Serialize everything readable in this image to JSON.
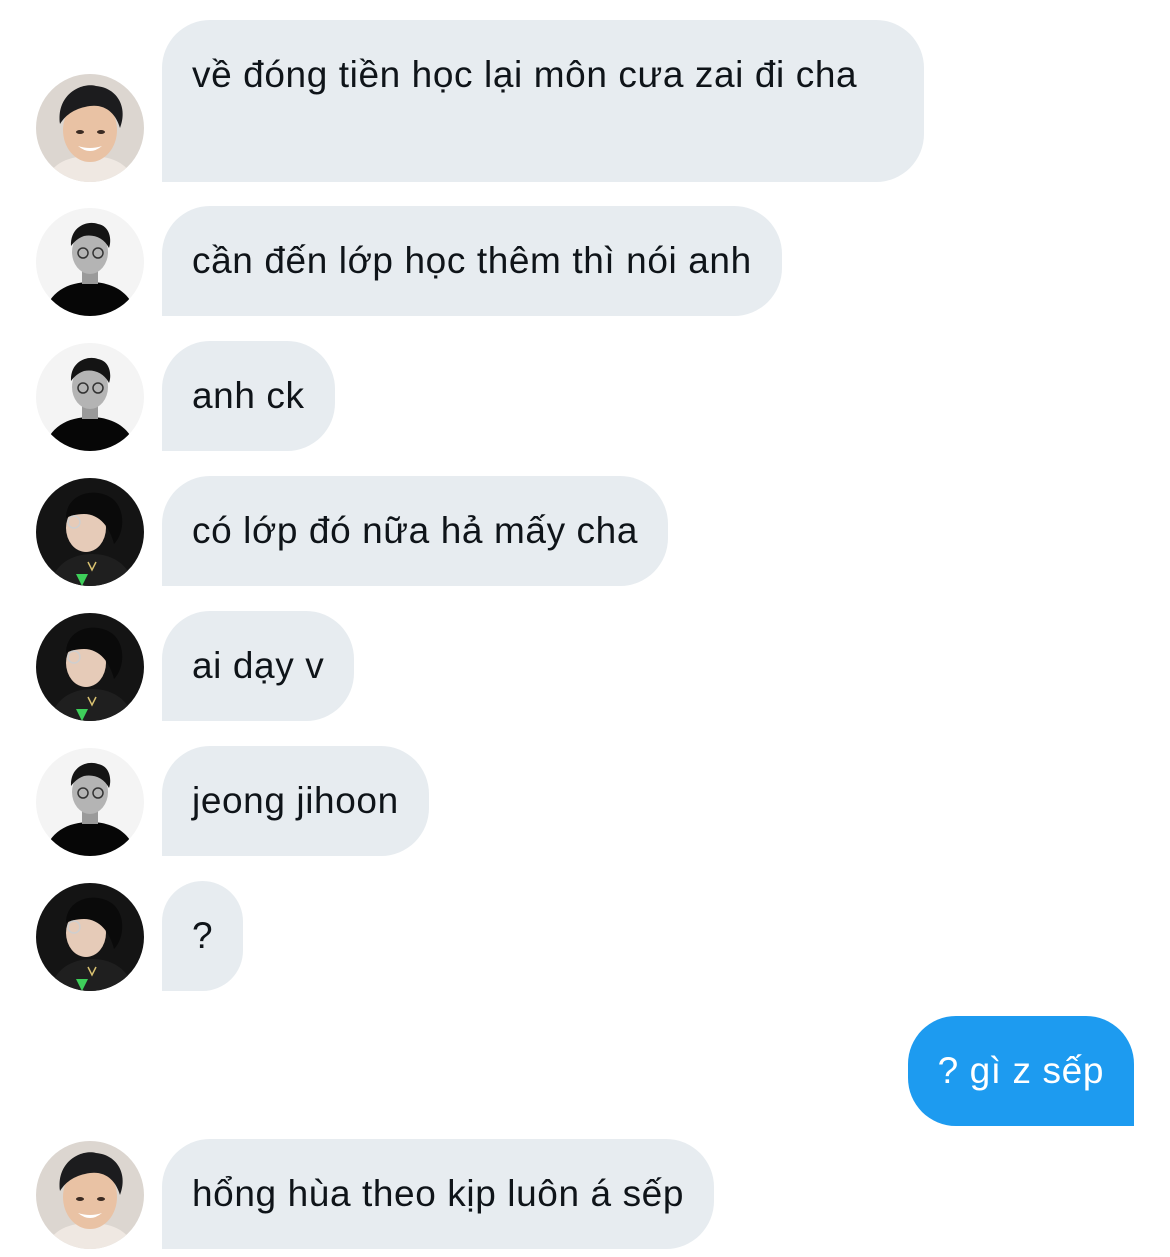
{
  "conversation": {
    "messages": [
      {
        "sender": "avatar-smiling-guy",
        "text": "về đóng tiền học lại môn cưa zai đi cha"
      },
      {
        "sender": "avatar-guy-glasses-bw",
        "text": "cần đến lớp học thêm thì nói anh"
      },
      {
        "sender": "avatar-guy-glasses-bw",
        "text": "anh ck"
      },
      {
        "sender": "avatar-guy-profile-dark",
        "text": "có lớp đó nữa hả mấy cha"
      },
      {
        "sender": "avatar-guy-profile-dark",
        "text": "ai dạy v"
      },
      {
        "sender": "avatar-guy-glasses-bw",
        "text": "jeong jihoon"
      },
      {
        "sender": "avatar-guy-profile-dark",
        "text": "?"
      },
      {
        "sender": "me",
        "text": "? gì z sếp"
      },
      {
        "sender": "avatar-smiling-guy",
        "text": "hổng hùa theo kịp luôn á sếp"
      }
    ]
  },
  "colors": {
    "received_bubble": "#e7ecf0",
    "sent_bubble": "#1d9bf0",
    "received_text": "#0f1419",
    "sent_text": "#ffffff"
  }
}
